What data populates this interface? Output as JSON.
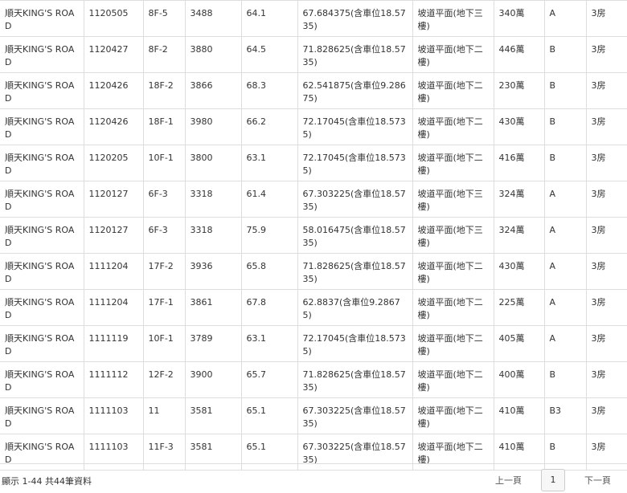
{
  "table": {
    "rows": [
      {
        "project": "順天KING'S ROAD",
        "date": "1120505",
        "floor": "8F-5",
        "price": "3488",
        "area": "64.1",
        "detail": "67.684375(含車位18.5735)",
        "parking": "坡道平面(地下三樓)",
        "parking_price": "340萬",
        "grade": "A",
        "rooms": "3房"
      },
      {
        "project": "順天KING'S ROAD",
        "date": "1120427",
        "floor": "8F-2",
        "price": "3880",
        "area": "64.5",
        "detail": "71.828625(含車位18.5735)",
        "parking": "坡道平面(地下二樓)",
        "parking_price": "446萬",
        "grade": "B",
        "rooms": "3房"
      },
      {
        "project": "順天KING'S ROAD",
        "date": "1120426",
        "floor": "18F-2",
        "price": "3866",
        "area": "68.3",
        "detail": "62.541875(含車位9.28675)",
        "parking": "坡道平面(地下二樓)",
        "parking_price": "230萬",
        "grade": "B",
        "rooms": "3房"
      },
      {
        "project": "順天KING'S ROAD",
        "date": "1120426",
        "floor": "18F-1",
        "price": "3980",
        "area": "66.2",
        "detail": "72.17045(含車位18.5735)",
        "parking": "坡道平面(地下二樓)",
        "parking_price": "430萬",
        "grade": "B",
        "rooms": "3房"
      },
      {
        "project": "順天KING'S ROAD",
        "date": "1120205",
        "floor": "10F-1",
        "price": "3800",
        "area": "63.1",
        "detail": "72.17045(含車位18.5735)",
        "parking": "坡道平面(地下二樓)",
        "parking_price": "416萬",
        "grade": "B",
        "rooms": "3房"
      },
      {
        "project": "順天KING'S ROAD",
        "date": "1120127",
        "floor": "6F-3",
        "price": "3318",
        "area": "61.4",
        "detail": "67.303225(含車位18.5735)",
        "parking": "坡道平面(地下三樓)",
        "parking_price": "324萬",
        "grade": "A",
        "rooms": "3房"
      },
      {
        "project": "順天KING'S ROAD",
        "date": "1120127",
        "floor": "6F-3",
        "price": "3318",
        "area": "75.9",
        "detail": "58.016475(含車位18.5735)",
        "parking": "坡道平面(地下三樓)",
        "parking_price": "324萬",
        "grade": "A",
        "rooms": "3房"
      },
      {
        "project": "順天KING'S ROAD",
        "date": "1111204",
        "floor": "17F-2",
        "price": "3936",
        "area": "65.8",
        "detail": "71.828625(含車位18.5735)",
        "parking": "坡道平面(地下二樓)",
        "parking_price": "430萬",
        "grade": "A",
        "rooms": "3房"
      },
      {
        "project": "順天KING'S ROAD",
        "date": "1111204",
        "floor": "17F-1",
        "price": "3861",
        "area": "67.8",
        "detail": "62.8837(含車位9.28675)",
        "parking": "坡道平面(地下二樓)",
        "parking_price": "225萬",
        "grade": "A",
        "rooms": "3房"
      },
      {
        "project": "順天KING'S ROAD",
        "date": "1111119",
        "floor": "10F-1",
        "price": "3789",
        "area": "63.1",
        "detail": "72.17045(含車位18.5735)",
        "parking": "坡道平面(地下二樓)",
        "parking_price": "405萬",
        "grade": "A",
        "rooms": "3房"
      },
      {
        "project": "順天KING'S ROAD",
        "date": "1111112",
        "floor": "12F-2",
        "price": "3900",
        "area": "65.7",
        "detail": "71.828625(含車位18.5735)",
        "parking": "坡道平面(地下二樓)",
        "parking_price": "400萬",
        "grade": "B",
        "rooms": "3房"
      },
      {
        "project": "順天KING'S ROAD",
        "date": "1111103",
        "floor": "11",
        "price": "3581",
        "area": "65.1",
        "detail": "67.303225(含車位18.5735)",
        "parking": "坡道平面(地下二樓)",
        "parking_price": "410萬",
        "grade": "B3",
        "rooms": "3房"
      },
      {
        "project": "順天KING'S ROAD",
        "date": "1111103",
        "floor": "11F-3",
        "price": "3581",
        "area": "65.1",
        "detail": "67.303225(含車位18.5735)",
        "parking": "坡道平面(地下二樓)",
        "parking_price": "410萬",
        "grade": "B",
        "rooms": "3房"
      }
    ]
  },
  "footer": {
    "summary": "顯示 1-44 共44筆資料",
    "prev_label": "上一頁",
    "current_page": "1",
    "next_label": "下一頁"
  }
}
